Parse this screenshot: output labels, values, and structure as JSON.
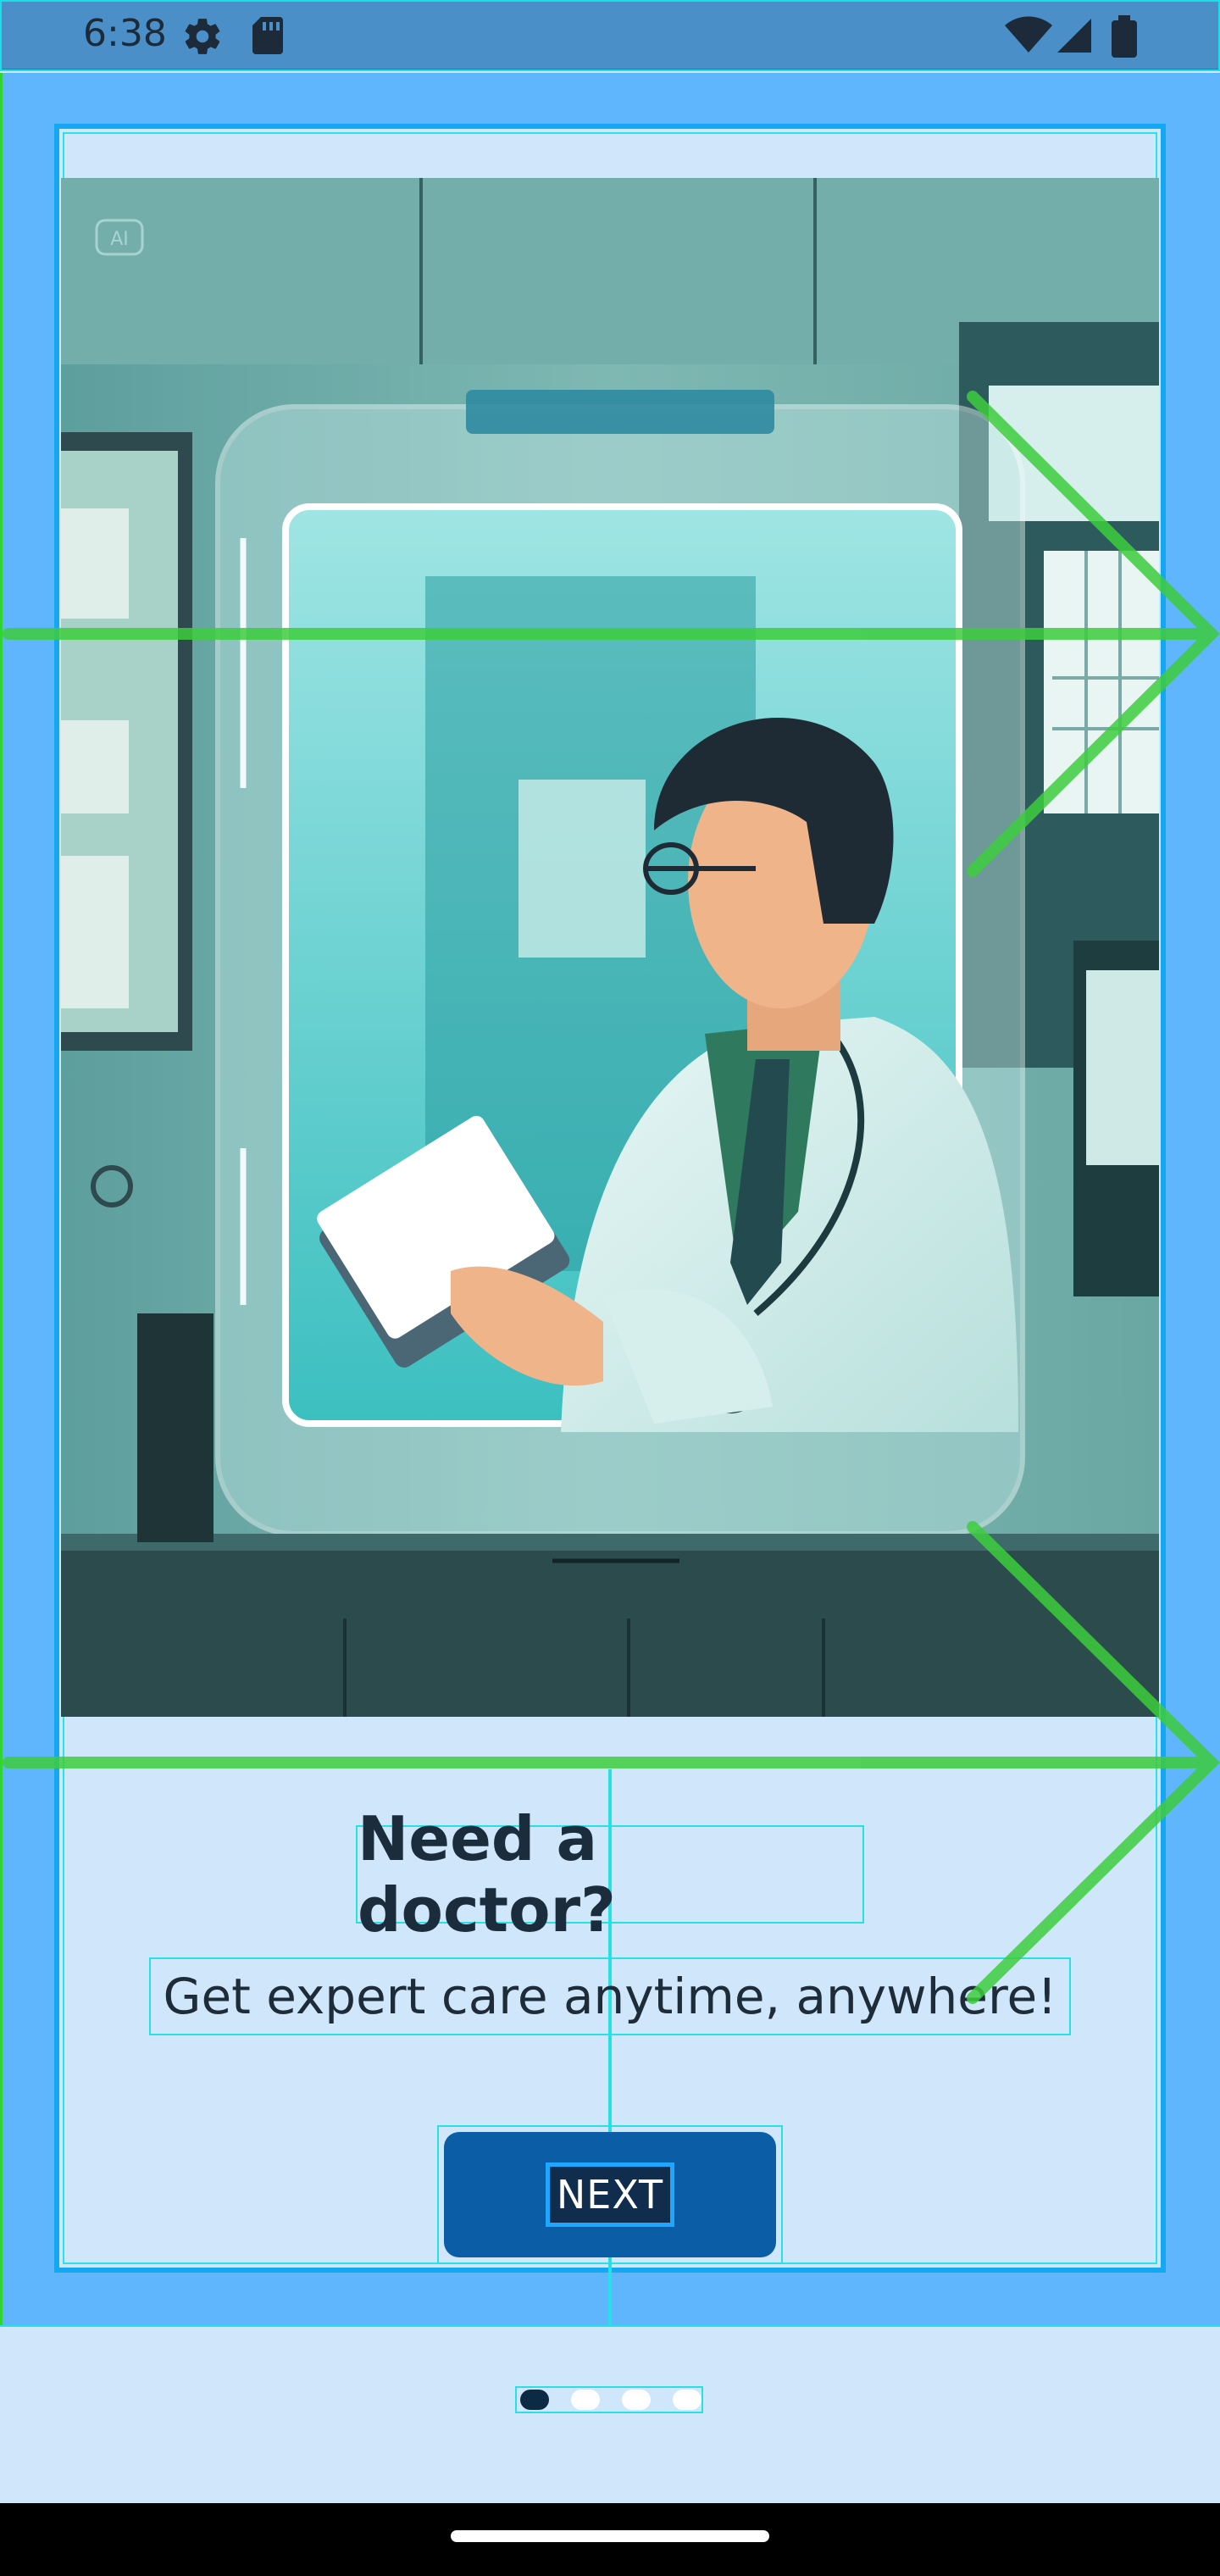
{
  "status_bar": {
    "time": "6:38",
    "icons": [
      "gear-icon",
      "sd-card-icon",
      "wifi-icon",
      "signal-icon",
      "battery-icon"
    ]
  },
  "onboarding": {
    "illustration_badge": "AI",
    "title": "Need a doctor?",
    "subtitle": "Get expert care anytime, anywhere!",
    "next_label": "NEXT"
  },
  "pager": {
    "page_count": 4,
    "active_index": 0
  },
  "colors": {
    "accent": "#0b5ea5",
    "card_border": "#15a8f2",
    "background": "#cfe6fb",
    "overlay_arrow": "#3dcc3d"
  }
}
